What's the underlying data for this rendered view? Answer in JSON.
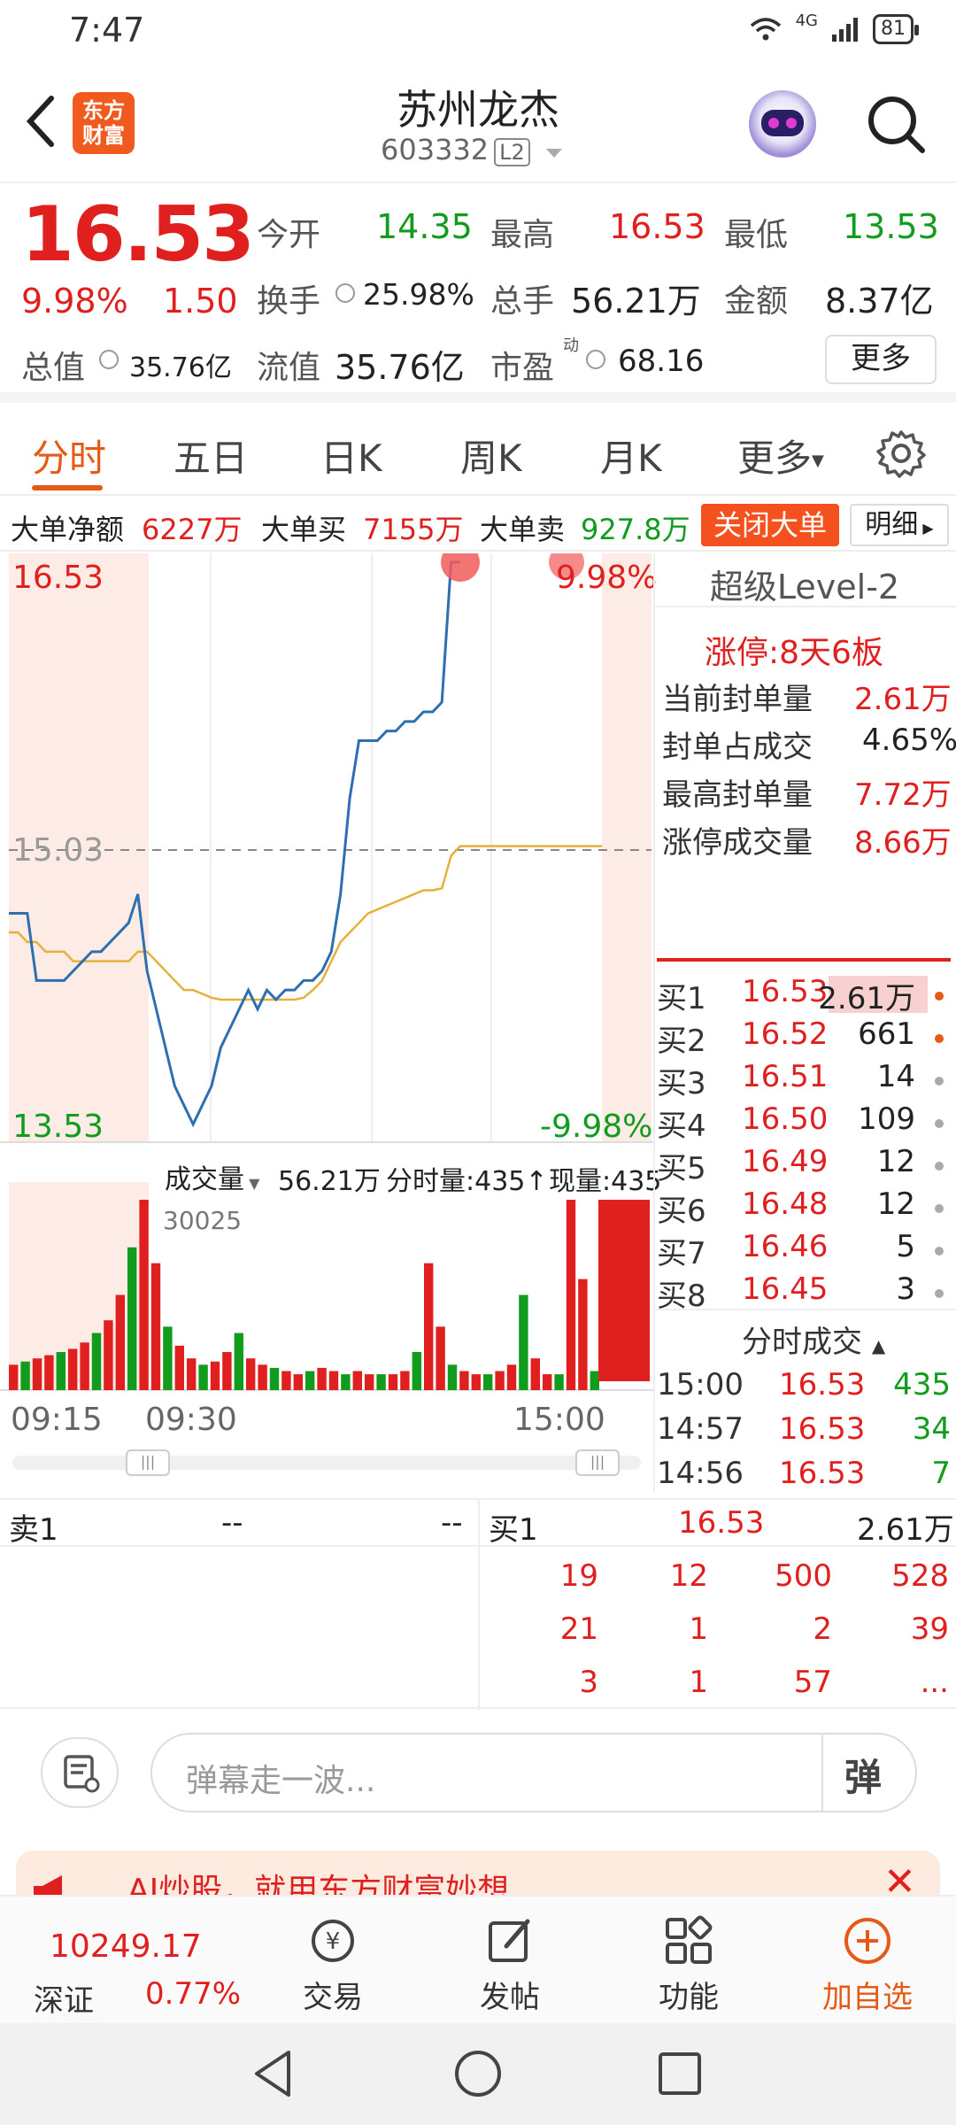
{
  "status": {
    "time": "7:47",
    "signal": "4G",
    "battery": "81"
  },
  "header": {
    "logo_line1": "东方",
    "logo_line2": "财富",
    "title": "苏州龙杰",
    "code": "603332",
    "level_badge": "L2"
  },
  "quote": {
    "price": "16.53",
    "pct": "9.98%",
    "change": "1.50",
    "open_label": "今开",
    "open": "14.35",
    "high_label": "最高",
    "high": "16.53",
    "low_label": "最低",
    "low": "13.53",
    "turnover_label": "换手",
    "turnover": "25.98%",
    "volume_label": "总手",
    "volume": "56.21万",
    "amount_label": "金额",
    "amount": "8.37亿",
    "mcap_label": "总值",
    "mcap": "35.76亿",
    "float_label": "流值",
    "float": "35.76亿",
    "pe_label": "市盈",
    "pe_sup": "动",
    "pe": "68.16",
    "more": "更多"
  },
  "tabs": {
    "t1": "分时",
    "t2": "五日",
    "t3": "日K",
    "t4": "周K",
    "t5": "月K",
    "t6": "更多"
  },
  "big_order": {
    "net_label": "大单净额",
    "net": "6227万",
    "buy_label": "大单买",
    "buy": "7155万",
    "sell_label": "大单卖",
    "sell": "927.8万",
    "close_btn": "关闭大单",
    "detail_btn": "明细"
  },
  "chart_data": {
    "type": "line",
    "title": "",
    "y_high": "16.53",
    "y_mid": "15.03",
    "y_low": "13.53",
    "pct_high": "9.98%",
    "pct_low": "-9.98%",
    "x_labels": [
      "09:15",
      "09:30",
      "15:00"
    ],
    "ylim": [
      13.53,
      16.53
    ],
    "price_series": [
      14.7,
      14.7,
      14.7,
      14.35,
      14.35,
      14.35,
      14.35,
      14.4,
      14.45,
      14.5,
      14.5,
      14.55,
      14.6,
      14.65,
      14.8,
      14.4,
      14.2,
      14.0,
      13.8,
      13.7,
      13.6,
      13.7,
      13.8,
      14.0,
      14.1,
      14.2,
      14.3,
      14.2,
      14.3,
      14.25,
      14.3,
      14.3,
      14.35,
      14.35,
      14.4,
      14.5,
      14.8,
      15.3,
      15.6,
      15.6,
      15.6,
      15.65,
      15.65,
      15.7,
      15.7,
      15.75,
      15.75,
      15.8,
      16.53,
      16.53
    ],
    "avg_series": [
      14.6,
      14.6,
      14.55,
      14.55,
      14.5,
      14.5,
      14.5,
      14.45,
      14.45,
      14.45,
      14.45,
      14.45,
      14.45,
      14.45,
      14.5,
      14.5,
      14.45,
      14.4,
      14.35,
      14.3,
      14.3,
      14.28,
      14.26,
      14.25,
      14.25,
      14.25,
      14.25,
      14.25,
      14.25,
      14.25,
      14.25,
      14.25,
      14.26,
      14.3,
      14.35,
      14.45,
      14.55,
      14.6,
      14.65,
      14.7,
      14.72,
      14.74,
      14.76,
      14.78,
      14.8,
      14.82,
      14.82,
      14.83,
      15.0,
      15.05
    ],
    "volume_label": "成交量",
    "volume_total": "56.21万",
    "minute_vol": "分时量:435↑",
    "now_vol": "现量:435",
    "vol_max_label": "30025",
    "volume_series": [
      8,
      9,
      10,
      11,
      12,
      13,
      15,
      18,
      22,
      30,
      45,
      60,
      40,
      20,
      14,
      10,
      8,
      9,
      12,
      18,
      10,
      8,
      7,
      6,
      5,
      6,
      7,
      6,
      5,
      6,
      5,
      5,
      5,
      6,
      12,
      40,
      20,
      8,
      6,
      5,
      5,
      6,
      8,
      30,
      10,
      5,
      5,
      60,
      35,
      6
    ]
  },
  "level2": {
    "title": "超级Level-2",
    "limit_label": "涨停:",
    "limit_value": "8天6板",
    "seal_label": "当前封单量",
    "seal": "2.61万",
    "seal_ratio_label": "封单占成交",
    "seal_ratio": "4.65%",
    "max_seal_label": "最高封单量",
    "max_seal": "7.72万",
    "limit_vol_label": "涨停成交量",
    "limit_vol": "8.66万",
    "bids": [
      {
        "name": "买1",
        "price": "16.53",
        "qty": "2.61万"
      },
      {
        "name": "买2",
        "price": "16.52",
        "qty": "661"
      },
      {
        "name": "买3",
        "price": "16.51",
        "qty": "14"
      },
      {
        "name": "买4",
        "price": "16.50",
        "qty": "109"
      },
      {
        "name": "买5",
        "price": "16.49",
        "qty": "12"
      },
      {
        "name": "买6",
        "price": "16.48",
        "qty": "12"
      },
      {
        "name": "买7",
        "price": "16.46",
        "qty": "5"
      },
      {
        "name": "买8",
        "price": "16.45",
        "qty": "3"
      }
    ],
    "trades_title": "分时成交",
    "trades": [
      {
        "time": "15:00",
        "price": "16.53",
        "vol": "435"
      },
      {
        "time": "14:57",
        "price": "16.53",
        "vol": "34"
      },
      {
        "time": "14:56",
        "price": "16.53",
        "vol": "7"
      }
    ]
  },
  "orderbook": {
    "sell_label": "卖1",
    "sell_price": "--",
    "sell_qty": "--",
    "buy_label": "买1",
    "buy_price": "16.53",
    "buy_qty": "2.61万",
    "rows": [
      [
        "19",
        "12",
        "500",
        "528"
      ],
      [
        "21",
        "1",
        "2",
        "39"
      ],
      [
        "3",
        "1",
        "57",
        "..."
      ]
    ]
  },
  "danmu": {
    "placeholder": "弹幕走一波...",
    "send": "弹"
  },
  "ai_banner": {
    "text": "AI炒股，就用东方财富妙想"
  },
  "index": {
    "value": "10249.17",
    "name": "深证",
    "pct": "0.77%"
  },
  "nav": {
    "trade": "交易",
    "post": "发帖",
    "func": "功能",
    "add": "加自选"
  },
  "colors": {
    "up": "#e0201e",
    "down": "#129c1e",
    "accent": "#e45a16"
  }
}
